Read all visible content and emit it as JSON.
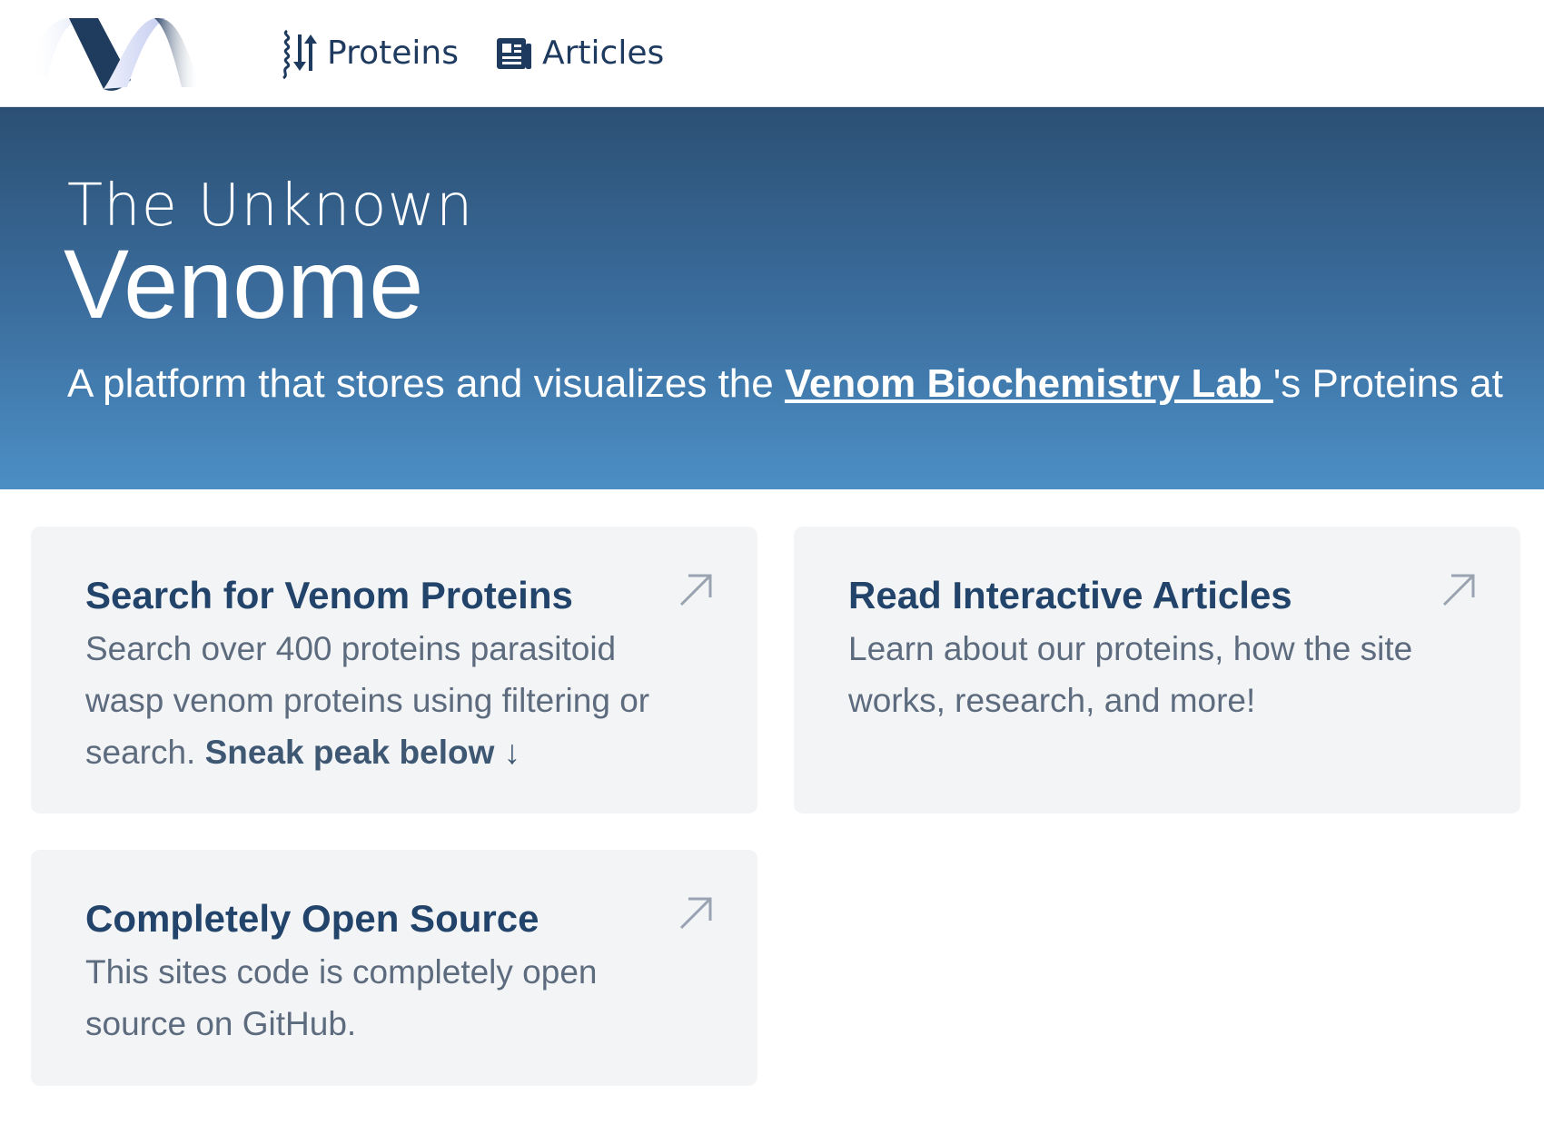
{
  "nav": {
    "logo_icon": "wave-ribbon-logo",
    "links": [
      {
        "label": "Proteins",
        "icon": "protein-helix-icon"
      },
      {
        "label": "Articles",
        "icon": "newspaper-icon"
      }
    ]
  },
  "hero": {
    "pre_title": "The Unknown",
    "title": "Venome",
    "subtitle_before": "A platform that stores and visualizes the ",
    "subtitle_link": "Venom Biochemistry Lab ",
    "subtitle_after": "'s Proteins at"
  },
  "cards": {
    "search": {
      "title": "Search for Venom Proteins",
      "body": "Search over 400 proteins parasitoid wasp venom proteins using filtering or search. ",
      "emph": "Sneak peak below ↓",
      "icon": "arrow-up-right-icon"
    },
    "articles": {
      "title": "Read Interactive Articles",
      "body": "Learn about our proteins, how the site works, research, and more!",
      "icon": "arrow-up-right-icon"
    },
    "opensource": {
      "title": "Completely Open Source",
      "body": "This sites code is completely open source on GitHub.",
      "icon": "arrow-up-right-icon"
    }
  },
  "colors": {
    "nav_text": "#1e3a5f",
    "hero_gradient_top": "#2c5074",
    "hero_gradient_bottom": "#4c8fc5",
    "card_bg": "#f3f4f6",
    "card_title": "#22436a",
    "card_body": "#5d6b7e"
  }
}
